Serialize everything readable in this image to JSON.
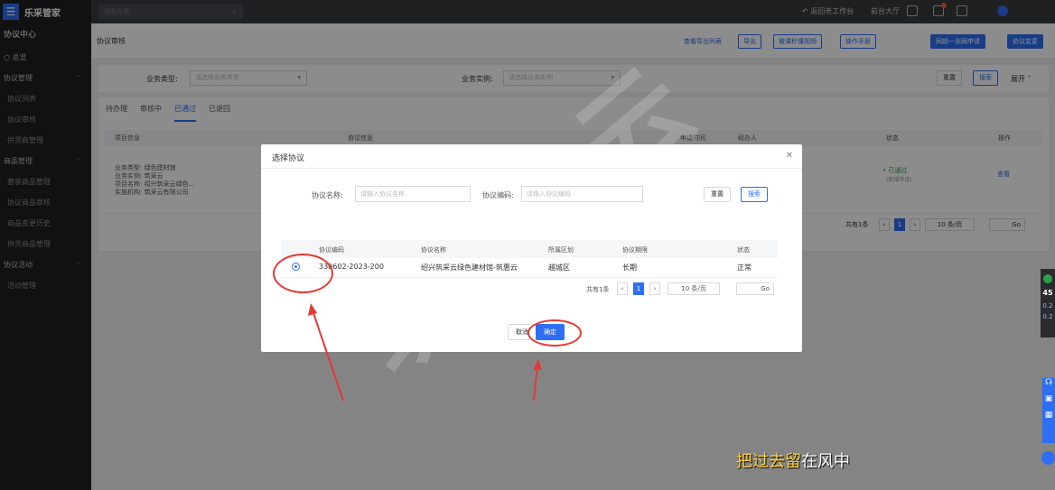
{
  "sidebar": {
    "logo": "乐采管家",
    "section_title": "协议中心",
    "items": [
      {
        "label": "总览",
        "sub": false
      },
      {
        "label": "协议管理",
        "sub": false,
        "caret": "^"
      },
      {
        "label": "协议列表",
        "sub": true
      },
      {
        "label": "协议审核",
        "sub": true
      },
      {
        "label": "供货商管理",
        "sub": true
      },
      {
        "label": "商品管理",
        "sub": false,
        "caret": "^"
      },
      {
        "label": "套装商品管理",
        "sub": true
      },
      {
        "label": "协议商品审核",
        "sub": true
      },
      {
        "label": "商品变更历史",
        "sub": true
      },
      {
        "label": "供货商品管理",
        "sub": true
      },
      {
        "label": "协议活动",
        "sub": false,
        "caret": "^"
      },
      {
        "label": "活动管理",
        "sub": true
      }
    ]
  },
  "topbar": {
    "search_placeholder": "搜索应用",
    "back_workbench": "返回老工作台",
    "front_hall": "前台大厅"
  },
  "subheader": {
    "breadcrumb": "协议审核",
    "view_export_list": "查看导出列表",
    "export": "导出",
    "video_help": "微课秒懂视频",
    "manual": "操作手册",
    "one_network": "网超一张网申请",
    "change": "协议变更"
  },
  "filter": {
    "biz_type_label": "业务类型:",
    "biz_type_placeholder": "请选择业务类型",
    "biz_instance_label": "业务实例:",
    "biz_instance_placeholder": "请选择业务实例",
    "reset": "重置",
    "search": "搜索",
    "expand": "展开"
  },
  "list": {
    "tabs": [
      "待办理",
      "审核中",
      "已通过",
      "已退回"
    ],
    "active_tab": 2,
    "headers": [
      "项目信息",
      "协议信息",
      "申请时间",
      "经办人",
      "状态",
      "操作"
    ],
    "row": {
      "lines": [
        "业务类型: 绿色建材馆",
        "业务实例: 筑采云",
        "项目名称: 绍兴筑采云绿色...",
        "实施机构: 筑采云有限公司"
      ],
      "num": "2",
      "status": "• 已通过",
      "status_sub": "(新增申请)",
      "action": "查看"
    },
    "pager": {
      "total": "共有1条",
      "page": "1",
      "per_page": "10 条/页",
      "go": "Go"
    }
  },
  "dialog": {
    "title": "选择协议",
    "name_label": "协议名称:",
    "name_placeholder": "请输入协议名称",
    "code_label": "协议编码:",
    "code_placeholder": "请输入协议编码",
    "reset": "重置",
    "search": "搜索",
    "headers": [
      "协议编码",
      "协议名称",
      "所属区划",
      "协议期限",
      "状态"
    ],
    "rows": [
      {
        "code": "330602-2023-200",
        "name": "绍兴筑采云绿色建材馆-筑惠云",
        "region": "越城区",
        "term": "长期",
        "status": "正常"
      }
    ],
    "pager": {
      "total": "共有1条",
      "page": "1",
      "per_page": "10 条/页",
      "go": "Go"
    },
    "cancel": "取消",
    "confirm": "确定"
  },
  "caption": {
    "part1": "把过去留",
    "part2": "在风中"
  },
  "side_widget": {
    "speed": "45",
    "up": "0.2",
    "down": "0.2"
  },
  "watermark": "筑 采 云",
  "colors": {
    "primary": "#2d6ef5",
    "annotation": "#e53935",
    "caption": "#ffd23c"
  }
}
